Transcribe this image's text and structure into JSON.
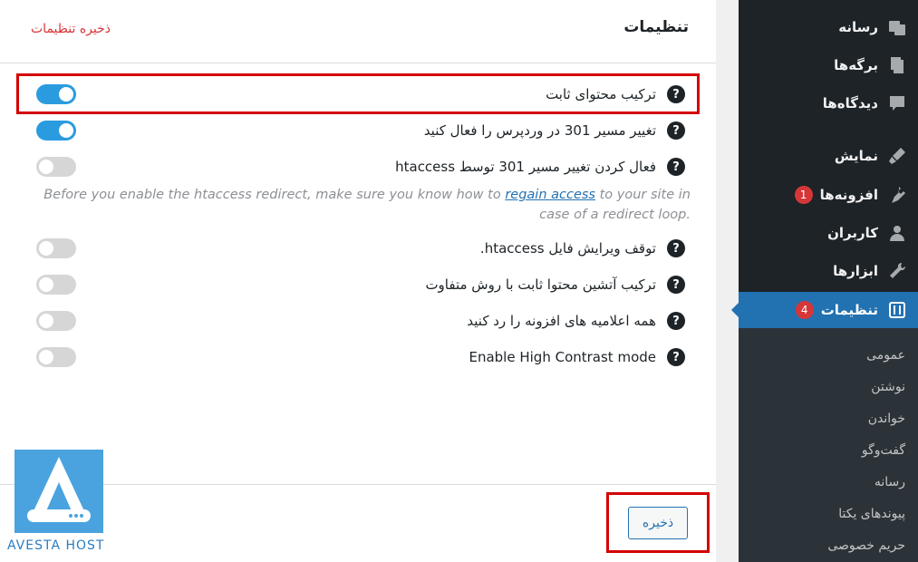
{
  "panel": {
    "title": "تنظیمات",
    "header_save_link": "ذخیره تنظیمات",
    "rows": [
      {
        "label": "ترکیب محتوای ثابت",
        "enabled": true
      },
      {
        "label": "تغییر مسیر 301 در وردپرس را فعال کنید",
        "enabled": true
      },
      {
        "label": "فعال کردن تغییر مسیر 301 توسط htaccess",
        "enabled": false
      },
      {
        "label": "توقف ویرایش فایل htaccess.",
        "enabled": false
      },
      {
        "label": "ترکیب آتشین محتوا ثابت با روش متفاوت",
        "enabled": false
      },
      {
        "label": "همه اعلامیه های افزونه را رد کنید",
        "enabled": false
      },
      {
        "label": "Enable High Contrast mode",
        "enabled": false
      }
    ],
    "help_glyph": "?",
    "notice": {
      "before": "Before you enable the htaccess redirect, make sure you know how to ",
      "link": "regain access",
      "after": " to your site in case of a redirect loop."
    },
    "save_button": "ذخیره"
  },
  "sidebar": {
    "items": [
      {
        "label": "رسانه",
        "icon": "media-icon"
      },
      {
        "label": "برگه‌ها",
        "icon": "pages-icon"
      },
      {
        "label": "دیدگاه‌ها",
        "icon": "comments-icon"
      },
      {
        "label": "نمایش",
        "icon": "appearance-icon"
      },
      {
        "label": "افزونه‌ها",
        "icon": "plugins-icon",
        "badge": "1"
      },
      {
        "label": "کاربران",
        "icon": "users-icon"
      },
      {
        "label": "ابزارها",
        "icon": "tools-icon"
      },
      {
        "label": "تنظیمات",
        "icon": "settings-icon",
        "badge": "4",
        "active": true
      }
    ],
    "submenu": [
      "عمومی",
      "نوشتن",
      "خواندن",
      "گفت‌وگو",
      "رسانه",
      "پیوندهای یکتا",
      "حریم خصوصی"
    ]
  },
  "logo": {
    "text": "AVESTA HOST"
  },
  "colors": {
    "accent": "#2271b1",
    "toggle_on": "#2b9be0",
    "highlight": "#d40000",
    "sidebar": "#1d2327"
  }
}
